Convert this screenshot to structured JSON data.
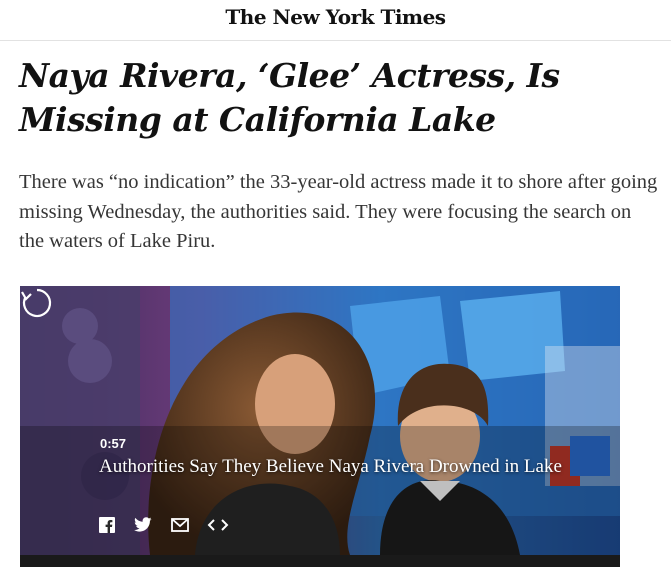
{
  "masthead": {
    "logo_text": "The New York Times"
  },
  "article": {
    "headline": "Naya Rivera, ‘Glee’ Actress, Is Missing at California Lake",
    "summary": "There was “no indication” the 33-year-old actress made it to shore after going missing Wednesday, the authorities said. They were focusing the search on the waters of Lake Piru."
  },
  "video": {
    "duration": "0:57",
    "title": "Authorities Say They Believe Naya Rivera Drowned in Lake",
    "icons": [
      "replay-icon",
      "facebook-icon",
      "twitter-icon",
      "email-icon",
      "embed-icon"
    ]
  },
  "colors": {
    "text": "#121212",
    "summary": "#363636",
    "video_bg": "#2a1f3c",
    "overlay_text": "#ffffff"
  }
}
